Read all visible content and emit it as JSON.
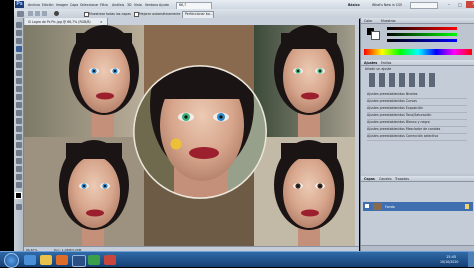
{
  "menubar": {
    "logo": "Ps",
    "items": [
      "Archivo",
      "Edición",
      "Imagen",
      "Capa",
      "Seleccionar",
      "Filtro",
      "Análisis",
      "3D",
      "Vista",
      "Ventana",
      "Ayuda"
    ],
    "zoom": "66,7",
    "workspace": "Básico",
    "whats_new": "What's New in CS5"
  },
  "options": {
    "sample_all": "Muestrear todas las capas",
    "auto_enhance": "Mejorar automáticamente",
    "refine": "Perfeccionar bo..."
  },
  "document": {
    "tab": "Si Logra de Ps Pic.jpg @ 66,7% (RGB/8)",
    "zoom": "66,67%",
    "doc_size": "Doc: 1,03M/3,29M"
  },
  "panels": {
    "color_tab": "Color",
    "swatches_tab": "Muestras",
    "adjust_tab": "Ajustes",
    "styles_tab": "Estilos",
    "add_adjustment": "Añadir un ajuste",
    "preset_rows": [
      "Ajustes preestablecidos Niveles",
      "Ajustes preestablecidos Curvas",
      "Ajustes preestablecidos Exposición",
      "Ajustes preestablecidos Tono/Saturación",
      "Ajustes preestablecidos Blanco y negro",
      "Ajustes preestablecidos Mezclador de canales",
      "Ajustes preestablecidos Corrección selectiva"
    ],
    "layers_tab": "Capas",
    "channels_tab": "Canales",
    "paths_tab": "Trazados",
    "layer_name": "Fondo"
  },
  "taskbar": {
    "time": "15:45",
    "date": "10/10/2020"
  },
  "colors": {
    "iris_blue": "#2f88c8",
    "iris_green": "#3bb07a",
    "iris_dark": "#3a2a20",
    "cursor": "#f2c52c"
  }
}
